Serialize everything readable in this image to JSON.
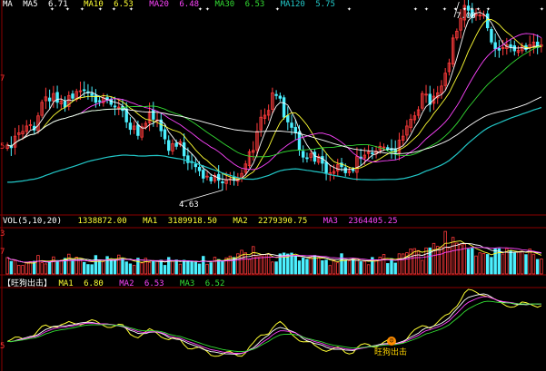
{
  "colors": {
    "background": "#000000",
    "grid": "#8b0000",
    "up": "#ff3b3b",
    "down": "#4cf0ff",
    "ma5": "#ffffff",
    "ma10": "#ffff33",
    "ma20": "#ff44ff",
    "ma30": "#33dd33",
    "ma60": "#ffffff",
    "ma120": "#22c8c8",
    "osc_main": "#ffff33",
    "osc_ma1": "#ffffff",
    "osc_ma2": "#ff44ff",
    "osc_ma3": "#33dd33"
  },
  "price_header": {
    "prefix": "MA",
    "items": [
      {
        "label": "MA5",
        "value": "6.71",
        "color": "#ffffff"
      },
      {
        "label": "MA10",
        "value": "6.53",
        "color": "#ffff33"
      },
      {
        "label": "MA20",
        "value": "6.48",
        "color": "#ff44ff"
      },
      {
        "label": "MA30",
        "value": "6.53",
        "color": "#33dd33"
      },
      {
        "label": "MA120",
        "value": "5.75",
        "color": "#22c8c8"
      }
    ]
  },
  "volume_header": {
    "title": "VOL(5,10,20)",
    "items": [
      {
        "label": "",
        "value": "1338872.00",
        "color": "#ffff33"
      },
      {
        "label": "MA1",
        "value": "3189918.50",
        "color": "#ffff33"
      },
      {
        "label": "MA2",
        "value": "2279390.75",
        "color": "#ffff33"
      },
      {
        "label": "MA3",
        "value": "2364405.25",
        "color": "#ff44ff"
      }
    ]
  },
  "indicator_header": {
    "title": "【旺狗出击】",
    "items": [
      {
        "label": "MA1",
        "value": "6.80",
        "color": "#ffff33"
      },
      {
        "label": "MA2",
        "value": "6.53",
        "color": "#ff44ff"
      },
      {
        "label": "MA3",
        "value": "6.52",
        "color": "#33dd33"
      }
    ]
  },
  "axis_labels": {
    "price": [
      "7",
      "5"
    ],
    "volume": [
      "3",
      "7"
    ],
    "indicator": [
      "5"
    ]
  },
  "annotations": {
    "high": "7.08",
    "low": "4.63",
    "signal": "旺狗出击",
    "signal_icon": "smiley-face-icon"
  },
  "chart_data": [
    {
      "type": "candlestick",
      "title": "",
      "ylim": [
        4.3,
        7.3
      ],
      "x": [
        1,
        2,
        3,
        4,
        5,
        6,
        7,
        8,
        9,
        10,
        11,
        12,
        13,
        14,
        15,
        16,
        17,
        18,
        19,
        20,
        21,
        22,
        23,
        24,
        25,
        26,
        27,
        28,
        29,
        30,
        31,
        32,
        33,
        34,
        35,
        36,
        37,
        38,
        39,
        40,
        41,
        42,
        43,
        44,
        45,
        46,
        47,
        48,
        49,
        50,
        51,
        52,
        53,
        54,
        55,
        56,
        57,
        58,
        59,
        60,
        61,
        62,
        63,
        64,
        65,
        66,
        67,
        68,
        69,
        70,
        71,
        72,
        73,
        74,
        75,
        76,
        77,
        78,
        79,
        80,
        81,
        82,
        83,
        84,
        85,
        86,
        87,
        88,
        89,
        90,
        91,
        92,
        93,
        94,
        95,
        96,
        97,
        98,
        99,
        100,
        101,
        102,
        103,
        104,
        105,
        106,
        107,
        108,
        109,
        110,
        111,
        112,
        113,
        114,
        115,
        116,
        117,
        118,
        119,
        120,
        121,
        122,
        123,
        124,
        125,
        126,
        127,
        128,
        129,
        130,
        131,
        132,
        133,
        134,
        135,
        136,
        137,
        138,
        139,
        140
      ],
      "close": [
        5.32,
        5.28,
        5.45,
        5.5,
        5.52,
        5.6,
        5.62,
        5.54,
        5.75,
        5.95,
        6.03,
        5.97,
        6.08,
        5.95,
        5.97,
        5.88,
        6.05,
        6.01,
        6.11,
        6.12,
        6.13,
        6.09,
        6.05,
        5.95,
        5.96,
        6.02,
        5.98,
        5.92,
        5.88,
        5.88,
        5.83,
        5.66,
        5.55,
        5.6,
        5.46,
        5.59,
        5.64,
        5.81,
        5.7,
        5.69,
        5.53,
        5.41,
        5.24,
        5.34,
        5.3,
        5.37,
        5.16,
        5.06,
        5.06,
        5.0,
        4.94,
        4.83,
        4.86,
        4.79,
        4.87,
        4.8,
        4.76,
        4.81,
        4.82,
        4.8,
        4.83,
        4.9,
        5.04,
        5.22,
        5.24,
        5.52,
        5.73,
        5.76,
        5.83,
        6.09,
        6.05,
        6.01,
        5.73,
        5.66,
        5.58,
        5.5,
        5.25,
        5.14,
        5.13,
        5.19,
        5.08,
        5.15,
        5.05,
        4.91,
        4.91,
        4.93,
        5.03,
        5.0,
        4.91,
        4.94,
        4.94,
        5.15,
        5.12,
        5.17,
        5.22,
        5.19,
        5.23,
        5.3,
        5.29,
        5.26,
        5.24,
        5.21,
        5.39,
        5.45,
        5.6,
        5.7,
        5.75,
        5.84,
        6.08,
        6.07,
        5.92,
        6.04,
        6.09,
        6.19,
        6.38,
        6.53,
        6.9,
        7.0,
        7.19,
        7.38,
        7.31,
        7.21,
        7.25,
        7.24,
        7.24,
        7.05,
        6.84,
        6.74,
        6.72,
        6.76,
        6.8,
        6.77,
        6.71,
        6.72,
        6.78,
        6.73,
        6.8,
        6.84,
        6.76,
        6.8
      ],
      "series": [
        {
          "name": "MA5",
          "color": "#ffffff"
        },
        {
          "name": "MA10",
          "color": "#ffff33"
        },
        {
          "name": "MA20",
          "color": "#ff44ff"
        },
        {
          "name": "MA30",
          "color": "#33dd33"
        },
        {
          "name": "MA120",
          "color": "#22c8c8"
        }
      ]
    },
    {
      "type": "bar",
      "title": "VOL(5,10,20)",
      "ylim": [
        0,
        5
      ],
      "values": [
        1.81,
        1.38,
        1.48,
        0.96,
        0.95,
        1.3,
        1.36,
        1.4,
        2.04,
        1.24,
        1.11,
        1.33,
        1.88,
        1.48,
        1.52,
        1.72,
        2.18,
        1.45,
        1.84,
        1.52,
        1.27,
        1.04,
        1.02,
        2.03,
        1.54,
        1.37,
        1.92,
        1.59,
        1.64,
        2.08,
        1.69,
        1.33,
        1.11,
        0.95,
        1.74,
        1.21,
        1.73,
        1.28,
        1.43,
        1.38,
        1.52,
        0.95,
        1.82,
        1.4,
        1.54,
        1.08,
        1.51,
        1.46,
        1.35,
        1.38,
        1.1,
        1.94,
        1.07,
        1.24,
        1.84,
        1.59,
        1.48,
        1.78,
        1.97,
        1.81,
        2.22,
        2.61,
        2.33,
        1.61,
        3.02,
        1.91,
        2.0,
        2.16,
        2.22,
        1.32,
        1.33,
        2.21,
        2.31,
        2.2,
        2.3,
        1.93,
        1.44,
        1.76,
        1.61,
        1.83,
        2.04,
        1.78,
        1.46,
        1.53,
        0.93,
        1.52,
        1.23,
        2.23,
        1.47,
        1.45,
        1.68,
        1.5,
        1.35,
        1.39,
        1.02,
        1.82,
        1.52,
        1.86,
        2.15,
        1.15,
        1.69,
        1.2,
        2.22,
        2.21,
        2.34,
        2.76,
        2.79,
        2.57,
        1.5,
        2.87,
        2.87,
        3.37,
        3.04,
        2.95,
        4.69,
        2.89,
        4.03,
        3.4,
        3.21,
        3.3,
        2.73,
        2.83,
        1.98,
        2.33,
        2.26,
        2.15,
        1.83,
        2.78,
        2.78,
        2.2,
        2.79,
        2.57,
        2.3,
        2.43,
        2.48,
        2.13,
        2.75,
        2.18,
        1.6,
        1.65
      ],
      "series": [
        {
          "name": "MA1",
          "color": "#ffff33"
        },
        {
          "name": "MA2",
          "color": "#ffff33"
        },
        {
          "name": "MA3",
          "color": "#ff44ff"
        }
      ]
    },
    {
      "type": "line",
      "title": "【旺狗出击】",
      "ylim": [
        4.3,
        7.4
      ],
      "series": [
        {
          "name": "",
          "color": "#ffff33"
        },
        {
          "name": "MA1",
          "color": "#ffffff"
        },
        {
          "name": "MA2",
          "color": "#ff44ff"
        },
        {
          "name": "MA3",
          "color": "#33dd33"
        }
      ]
    }
  ]
}
